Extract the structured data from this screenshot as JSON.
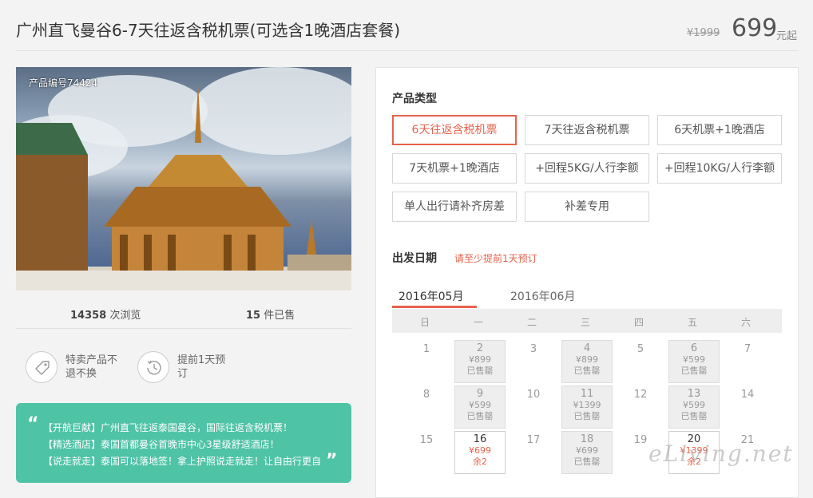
{
  "header": {
    "title": "广州直飞曼谷6-7天往返含税机票(可选含1晚酒店套餐)",
    "price_old": "¥1999",
    "price": "699",
    "price_unit": "元起"
  },
  "photo": {
    "code": "产品编号74424"
  },
  "stats": {
    "views_num": "14358",
    "views_label": "次浏览",
    "sold_num": "15",
    "sold_label": "件已售"
  },
  "features": [
    {
      "icon": "tag-icon",
      "text": "特卖产品不退不换"
    },
    {
      "icon": "history-icon",
      "text": "提前1天预订"
    }
  ],
  "promo": {
    "lines": [
      "【开航巨献】广州直飞往返泰国曼谷，国际往返含税机票！",
      "【精选酒店】泰国首都曼谷首晚市中心3星级舒适酒店！",
      "【说走就走】泰国可以落地签！拿上护照说走就走！让自由行更自"
    ]
  },
  "product_type": {
    "title": "产品类型",
    "options": [
      "6天往返含税机票",
      "7天往返含税机票",
      "6天机票+1晚酒店",
      "7天机票+1晚酒店",
      "+回程5KG/人行李额",
      "+回程10KG/人行李额",
      "单人出行请补齐房差",
      "补差专用"
    ],
    "selected": 0
  },
  "departure": {
    "title": "出发日期",
    "hint": "请至少提前1天预订",
    "months": [
      "2016年05月",
      "2016年06月"
    ],
    "weekdays": [
      "日",
      "一",
      "二",
      "三",
      "四",
      "五",
      "六"
    ],
    "days": {
      "d1": "1",
      "d2": "2",
      "d3": "3",
      "d4": "4",
      "d5": "5",
      "d6": "6",
      "d7": "7",
      "d8": "8",
      "d9": "9",
      "d10": "10",
      "d11": "11",
      "d12": "12",
      "d13": "13",
      "d14": "14",
      "d15": "15",
      "d16": "16",
      "d17": "17",
      "d18": "18",
      "d19": "19",
      "d20": "20",
      "d21": "21",
      "d2p": "¥899",
      "d2s": "已售罄",
      "d4p": "¥899",
      "d4s": "已售罄",
      "d6p": "¥599",
      "d6s": "已售罄",
      "d9p": "¥599",
      "d9s": "已售罄",
      "d11p": "¥1399",
      "d11s": "已售罄",
      "d13p": "¥599",
      "d13s": "已售罄",
      "d16p": "¥699",
      "d16s": "余2",
      "d18p": "¥699",
      "d18s": "已售罄",
      "d20p": "¥1399",
      "d20s": "余2"
    }
  },
  "watermark": "eLiving.net"
}
